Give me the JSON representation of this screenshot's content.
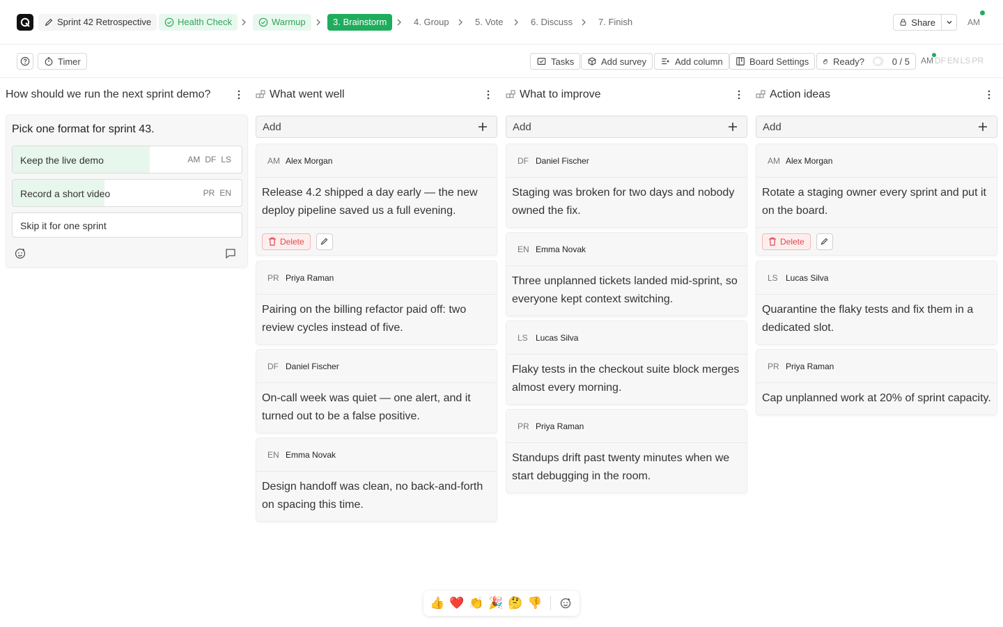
{
  "header": {
    "board_title": "Sprint 42 Retrospective",
    "steps": [
      {
        "label": "Health Check",
        "state": "done"
      },
      {
        "label": "Warmup",
        "state": "done"
      },
      {
        "label": "3. Brainstorm",
        "state": "active"
      },
      {
        "label": "4. Group",
        "state": "todo"
      },
      {
        "label": "5. Vote",
        "state": "todo"
      },
      {
        "label": "6. Discuss",
        "state": "todo"
      },
      {
        "label": "7. Finish",
        "state": "todo"
      }
    ],
    "share_label": "Share",
    "current_user": "AM"
  },
  "toolbar": {
    "timer_label": "Timer",
    "tasks_label": "Tasks",
    "add_survey_label": "Add survey",
    "add_column_label": "Add column",
    "board_settings_label": "Board Settings",
    "ready_label": "Ready?",
    "ready_count": "0 / 5",
    "presence": [
      "AM",
      "DF",
      "EN",
      "LS",
      "PR"
    ]
  },
  "poll": {
    "title": "How should we run the next sprint demo?",
    "question": "Pick one format for sprint 43.",
    "options": [
      {
        "label": "Keep the live demo",
        "voters": [
          "AM",
          "DF",
          "LS"
        ],
        "share": 0.6
      },
      {
        "label": "Record a short video",
        "voters": [
          "PR",
          "EN"
        ],
        "share": 0.4
      },
      {
        "label": "Skip it for one sprint",
        "voters": [],
        "share": 0
      }
    ]
  },
  "add_label": "Add",
  "delete_label": "Delete",
  "columns": [
    {
      "title": "What went well",
      "cards": [
        {
          "initials": "AM",
          "author": "Alex Morgan",
          "text": "Release 4.2 shipped a day early — the new deploy pipeline saved us a full evening.",
          "own": true
        },
        {
          "initials": "PR",
          "author": "Priya Raman",
          "text": "Pairing on the billing refactor paid off: two review cycles instead of five.",
          "own": false
        },
        {
          "initials": "DF",
          "author": "Daniel Fischer",
          "text": "On-call week was quiet — one alert, and it turned out to be a false positive.",
          "own": false
        },
        {
          "initials": "EN",
          "author": "Emma Novak",
          "text": "Design handoff was clean, no back-and-forth on spacing this time.",
          "own": false
        }
      ]
    },
    {
      "title": "What to improve",
      "cards": [
        {
          "initials": "DF",
          "author": "Daniel Fischer",
          "text": "Staging was broken for two days and nobody owned the fix.",
          "own": false
        },
        {
          "initials": "EN",
          "author": "Emma Novak",
          "text": "Three unplanned tickets landed mid-sprint, so everyone kept context switching.",
          "own": false
        },
        {
          "initials": "LS",
          "author": "Lucas Silva",
          "text": "Flaky tests in the checkout suite block merges almost every morning.",
          "own": false
        },
        {
          "initials": "PR",
          "author": "Priya Raman",
          "text": "Standups drift past twenty minutes when we start debugging in the room.",
          "own": false
        }
      ]
    },
    {
      "title": "Action ideas",
      "cards": [
        {
          "initials": "AM",
          "author": "Alex Morgan",
          "text": "Rotate a staging owner every sprint and put it on the board.",
          "own": true
        },
        {
          "initials": "LS",
          "author": "Lucas Silva",
          "text": "Quarantine the flaky tests and fix them in a dedicated slot.",
          "own": false
        },
        {
          "initials": "PR",
          "author": "Priya Raman",
          "text": "Cap unplanned work at 20% of sprint capacity.",
          "own": false
        }
      ]
    }
  ],
  "reactions": [
    {
      "emoji": "👍",
      "icon": "thumbs-up"
    },
    {
      "emoji": "❤️",
      "icon": "heart"
    },
    {
      "emoji": "👏",
      "icon": "clap"
    },
    {
      "emoji": "🎉",
      "icon": "party"
    },
    {
      "emoji": "🤔",
      "icon": "thinking"
    },
    {
      "emoji": "👎",
      "icon": "thumbs-down"
    }
  ]
}
